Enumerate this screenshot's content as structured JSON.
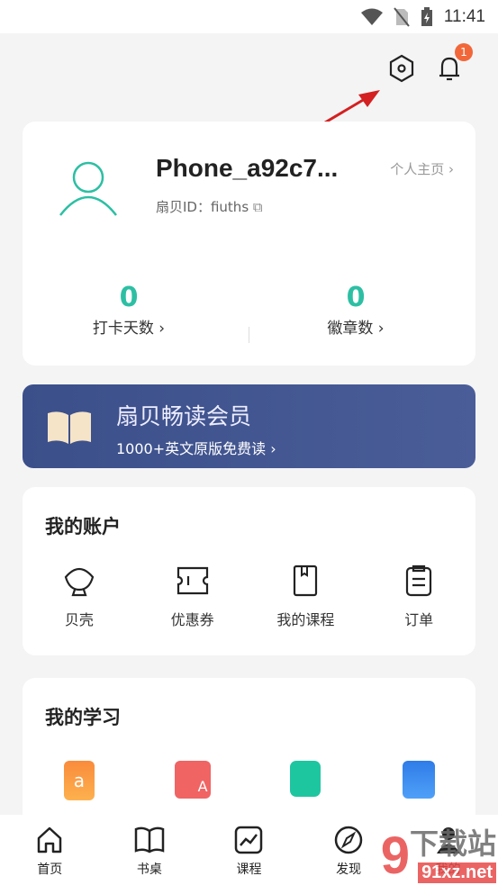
{
  "status": {
    "time": "11:41"
  },
  "header": {
    "notification_count": "1"
  },
  "profile": {
    "username": "Phone_a92c7...",
    "id_label": "扇贝ID：fiuths",
    "homepage_link": "个人主页 ›",
    "stats": [
      {
        "value": "0",
        "label": "打卡天数 ›"
      },
      {
        "value": "0",
        "label": "徽章数 ›"
      }
    ]
  },
  "vip": {
    "title": "扇贝畅读会员",
    "subtitle": "1000+英文原版免费读 ›"
  },
  "account": {
    "title": "我的账户",
    "items": [
      {
        "label": "贝壳",
        "icon": "shell-icon"
      },
      {
        "label": "优惠券",
        "icon": "coupon-icon"
      },
      {
        "label": "我的课程",
        "icon": "book-icon"
      },
      {
        "label": "订单",
        "icon": "order-icon"
      }
    ]
  },
  "study": {
    "title": "我的学习",
    "colors": [
      "#f98b3c",
      "#f06464",
      "#1ec6a0",
      "#2f7ce8"
    ]
  },
  "nav": {
    "tabs": [
      {
        "label": "首页"
      },
      {
        "label": "书桌"
      },
      {
        "label": "课程"
      },
      {
        "label": "发现"
      },
      {
        "label": "我的"
      }
    ]
  },
  "watermark": {
    "text": "91下载站",
    "url": "91xz.net"
  },
  "colors": {
    "accent": "#2dbfa4",
    "badge": "#f2673a",
    "vip_bg": "#3b4f8a"
  }
}
